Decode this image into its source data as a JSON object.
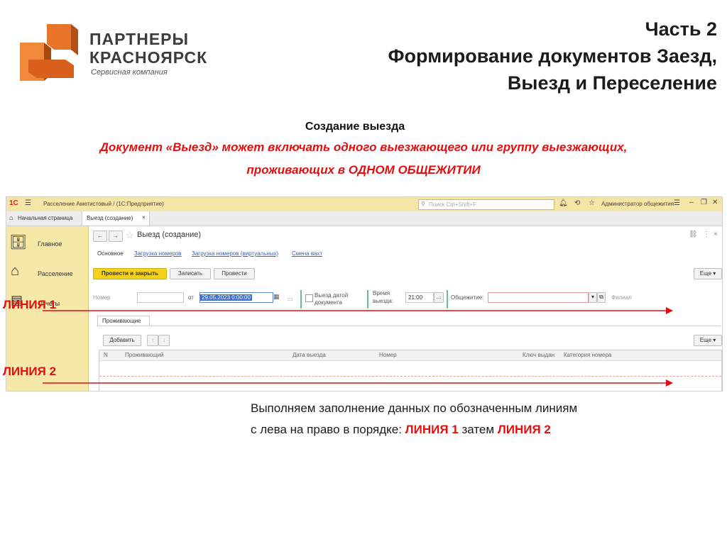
{
  "logo": {
    "line1": "ПАРТНЕРЫ",
    "line2": "КРАСНОЯРСК",
    "line3": "Сервисная компания",
    "brand_color": "#e8742a"
  },
  "header": {
    "part": "Часть 2",
    "title_line1": "Формирование документов Заезд,",
    "title_line2": "Выезд и Переселение"
  },
  "section": {
    "subtitle": "Создание выезда",
    "note_line1": "Документ «Выезд» может включать одного выезжающего или группу выезжающих,",
    "note_line2": "проживающих в ОДНОМ ОБЩЕЖИТИИ"
  },
  "app": {
    "logo_label": "1С",
    "window_title": "Расселение Аметистовый / (1С:Предприятие)",
    "search_placeholder": "Поиск Ctrl+Shift+F",
    "user": "Администратор общежития",
    "tabs": {
      "home": "Начальная страница",
      "current": "Выезд (создание)"
    },
    "sidebar": {
      "items": [
        {
          "label": "Главное",
          "icon": "desk-icon"
        },
        {
          "label": "Расселение",
          "icon": "house-icon"
        },
        {
          "label": "Отчеты",
          "icon": "report-icon"
        }
      ]
    },
    "form": {
      "title": "Выезд (создание)",
      "subtabs": [
        "Основное",
        "Загрузка номеров",
        "Загрузка номеров (виртуальных)",
        "Смена вахт"
      ],
      "buttons": {
        "post_close": "Провести и закрыть",
        "save": "Записать",
        "post": "Провести",
        "more": "Еще"
      },
      "fields": {
        "number_label": "Номер",
        "from_label": "от",
        "date_value": "29.05.2023 0:00:00",
        "checkout_date_label_1": "Выезд датой",
        "checkout_date_label_2": "документа",
        "time_label_1": "Время",
        "time_label_2": "выезда:",
        "time_value": "21:00",
        "dormitory_label": "Общежитие:",
        "branch_label": "Филиал"
      },
      "residents_tab": "Проживающие",
      "add_button": "Добавить",
      "table_more": "Еще",
      "columns": [
        "N",
        "Проживающий",
        "Дата выезда",
        "Номер",
        "Ключ выдан",
        "Категория номера"
      ]
    }
  },
  "annotations": {
    "line1": "ЛИНИЯ 1",
    "line2": "ЛИНИЯ 2",
    "arrow_color": "#e01010"
  },
  "instructions": {
    "line1": "Выполняем заполнение данных по обозначенным линиям",
    "line2_prefix": "с лева на право в порядке:",
    "line2_mid": "затем",
    "step1": "ЛИНИЯ 1",
    "step2": "ЛИНИЯ 2"
  }
}
